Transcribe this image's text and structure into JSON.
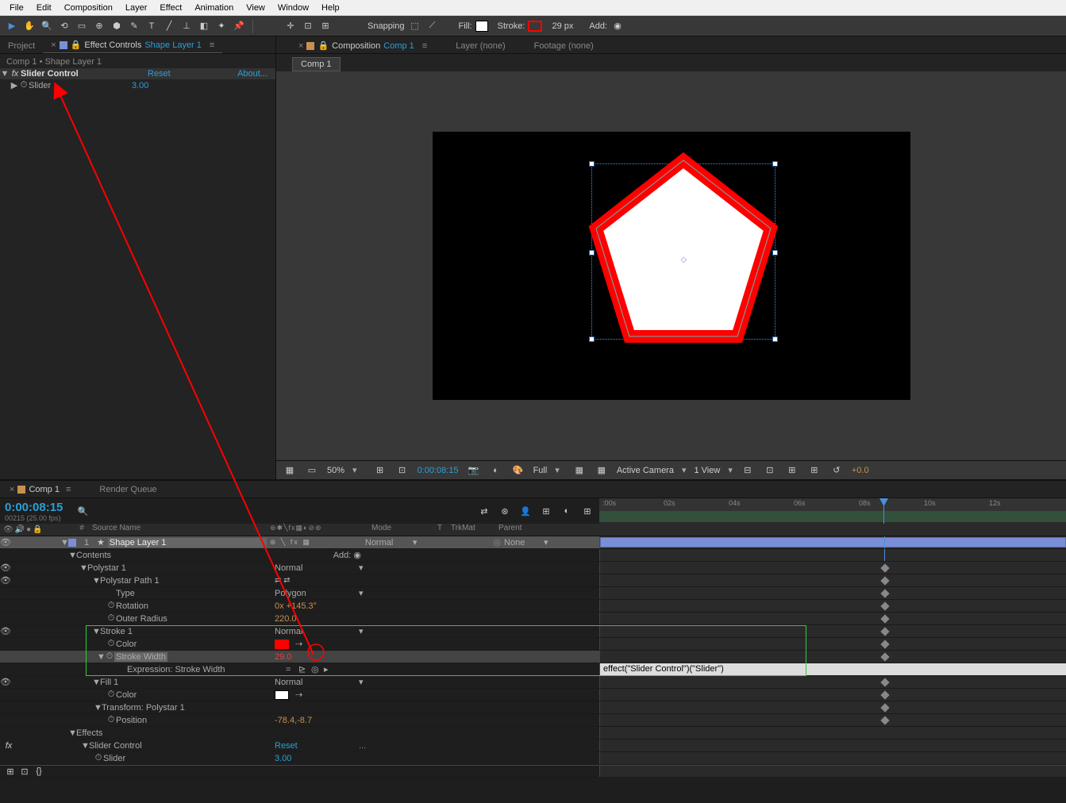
{
  "menu": [
    "File",
    "Edit",
    "Composition",
    "Layer",
    "Effect",
    "Animation",
    "View",
    "Window",
    "Help"
  ],
  "toolbar": {
    "snapping": "Snapping",
    "fill": "Fill:",
    "stroke": "Stroke:",
    "stroke_px": "29 px",
    "add": "Add:"
  },
  "project_tab": "Project",
  "effect_controls_tab": "Effect Controls",
  "effect_controls_target": "Shape Layer 1",
  "ec_breadcrumb": "Comp 1 • Shape Layer 1",
  "ec": {
    "effect_name": "Slider Control",
    "reset": "Reset",
    "about": "About...",
    "param_name": "Slider",
    "param_value": "3.00"
  },
  "comp_tabs": {
    "composition": "Composition",
    "composition_name": "Comp 1",
    "layer_none": "Layer (none)",
    "footage_none": "Footage (none)"
  },
  "comp_subtab": "Comp 1",
  "viewer_footer": {
    "zoom": "50%",
    "time": "0:00:08:15",
    "res": "Full",
    "camera": "Active Camera",
    "views": "1 View",
    "exposure": "+0.0"
  },
  "timeline": {
    "tab_comp": "Comp 1",
    "tab_render": "Render Queue",
    "timecode": "0:00:08:15",
    "timecode_sub": "00215 (25.00 fps)",
    "ruler": [
      ":00s",
      "02s",
      "04s",
      "06s",
      "08s",
      "10s",
      "12s"
    ],
    "col_num": "#",
    "col_source": "Source Name",
    "col_mode": "Mode",
    "col_t": "T",
    "col_trk": "TrkMat",
    "col_parent": "Parent",
    "layer_num": "1",
    "layer_name": "Shape Layer 1",
    "mode_normal": "Normal",
    "parent_none": "None",
    "contents": "Contents",
    "add": "Add:",
    "polystar1": "Polystar 1",
    "polystar_path1": "Polystar Path 1",
    "type": "Type",
    "type_val": "Polygon",
    "rotation": "Rotation",
    "rotation_val": "0x +145.3°",
    "outer_radius": "Outer Radius",
    "outer_radius_val": "220.0",
    "stroke1": "Stroke 1",
    "color": "Color",
    "stroke_width": "Stroke Width",
    "stroke_width_val": "29.0",
    "expr_stroke_width": "Expression: Stroke Width",
    "expr_text": "effect(\"Slider Control\")(\"Slider\")",
    "fill1": "Fill 1",
    "transform_polystar": "Transform: Polystar 1",
    "position": "Position",
    "position_val": "-78.4,-8.7",
    "effects": "Effects",
    "slider_control": "Slider Control",
    "reset": "Reset",
    "slider": "Slider",
    "slider_val": "3.00"
  }
}
